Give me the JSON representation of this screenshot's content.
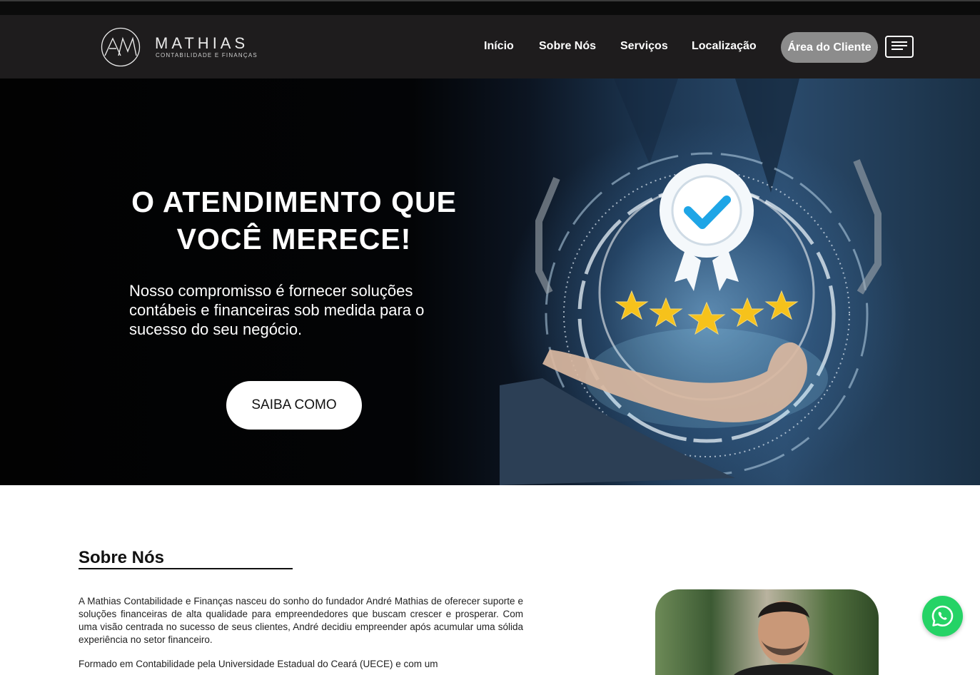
{
  "brand": {
    "name": "MATHIAS",
    "tagline": "CONTABILIDADE E FINANÇAS",
    "colors": {
      "header": "#1e1c1d",
      "client_button": "#8c8c8c",
      "whatsapp": "#25d366"
    }
  },
  "nav": {
    "items": [
      {
        "label": "Início"
      },
      {
        "label": "Sobre Nós"
      },
      {
        "label": "Serviços"
      },
      {
        "label": "Localização"
      }
    ],
    "client_area": "Área do Cliente",
    "menu_icon": "hamburger-menu-icon"
  },
  "hero": {
    "title_line1": "O ATENDIMENTO QUE",
    "title_line2": "VOCÊ MERECE!",
    "text": "Nosso compromisso é fornecer soluções contábeis e financeiras sob medida para o sucesso do seu negócio.",
    "cta": "SAIBA COMO",
    "rating_stars": 5
  },
  "about": {
    "title": "Sobre Nós",
    "paragraph1": "A Mathias Contabilidade e Finanças nasceu do sonho do fundador André Mathias de oferecer suporte e soluções financeiras de alta qualidade para empreendedores que buscam crescer e prosperar. Com uma visão centrada no sucesso de seus clientes, André decidiu empreender após acumular uma sólida experiência no setor financeiro.",
    "paragraph2": "Formado em Contabilidade pela Universidade Estadual do Ceará (UECE) e com um"
  },
  "floating": {
    "whatsapp_icon": "whatsapp-icon"
  }
}
